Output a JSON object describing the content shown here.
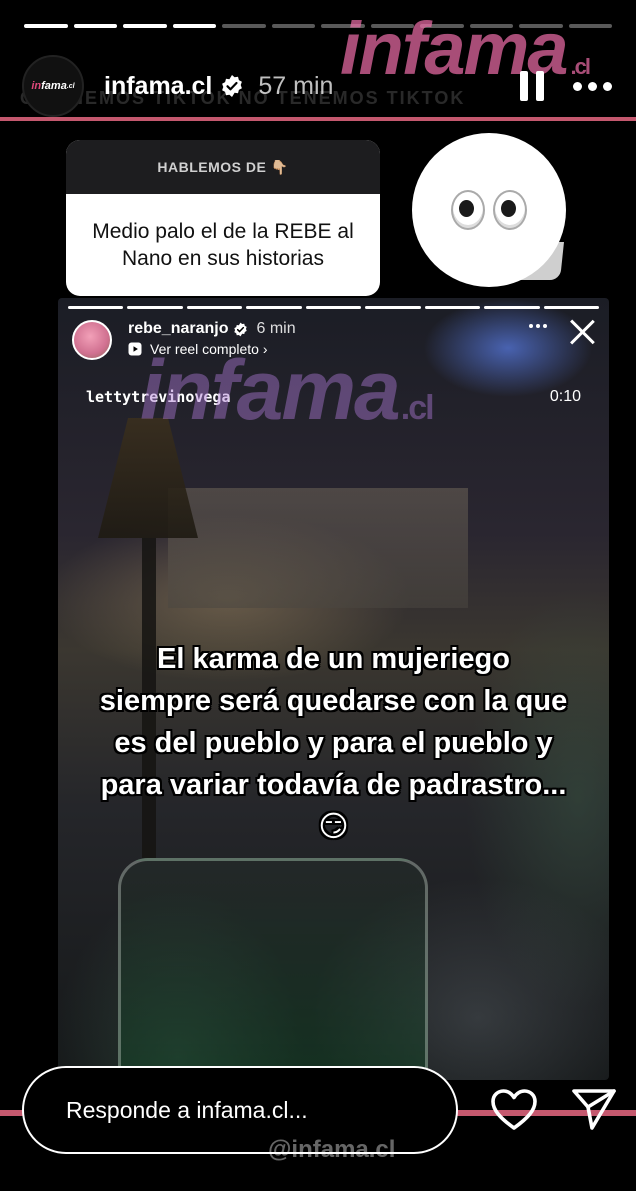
{
  "story": {
    "progress": {
      "total": 12,
      "completed": 4
    },
    "header": {
      "avatar_label_a": "in",
      "avatar_label_b": "fama",
      "avatar_label_c": ".cl",
      "username": "infama.cl",
      "time": "57 min"
    },
    "watermark": {
      "brand": "infama",
      "suffix": ".cl"
    },
    "background_text": "O TENEMOS TIKTOK  NO TENEMOS TIKTOK"
  },
  "question": {
    "title": "HABLEMOS DE 👇🏼",
    "text": "Medio palo el de  la REBE al Nano  en sus historias"
  },
  "reposted": {
    "progress": {
      "total": 9,
      "completed": 9
    },
    "username": "rebe_naranjo",
    "time": "6 min",
    "reel_link": "Ver reel completo ›",
    "source_username": "lettytrevinovega",
    "video_time": "0:10",
    "caption": "El karma de un mujeriego siempre será quedarse con la que es del pueblo y para el pueblo y para variar todavía de padrastro...😏"
  },
  "footer": {
    "reply_placeholder": "Responde a infama.cl...",
    "watermark": "@infama.cl"
  },
  "colors": {
    "accent_pink": "#c4586e",
    "watermark_pink": "#f06eaa"
  }
}
